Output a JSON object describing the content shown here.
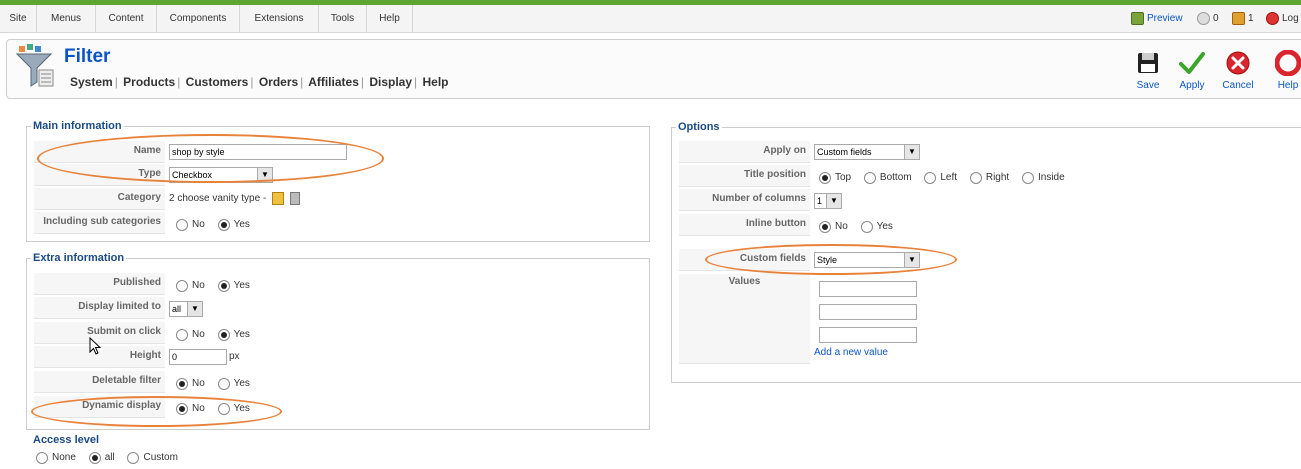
{
  "menubar": {
    "items": [
      "Site",
      "Menus",
      "Content",
      "Components",
      "Extensions",
      "Tools",
      "Help"
    ],
    "preview": "Preview",
    "messages_count": "0",
    "users_count": "1",
    "logout": "Log"
  },
  "header": {
    "title": "Filter",
    "submenu": [
      "System",
      "Products",
      "Customers",
      "Orders",
      "Affiliates",
      "Display",
      "Help"
    ]
  },
  "toolbar": {
    "save": "Save",
    "apply": "Apply",
    "cancel": "Cancel",
    "help": "Help"
  },
  "main_info": {
    "legend": "Main information",
    "name_label": "Name",
    "name_value": "shop by style",
    "type_label": "Type",
    "type_value": "Checkbox",
    "category_label": "Category",
    "category_value": "2 choose vanity type -",
    "sub_label": "Including sub categories",
    "no": "No",
    "yes": "Yes"
  },
  "extra_info": {
    "legend": "Extra information",
    "published_label": "Published",
    "limited_label": "Display limited to",
    "limited_value": "all",
    "submit_label": "Submit on click",
    "height_label": "Height",
    "height_value": "0",
    "height_unit": "px",
    "deletable_label": "Deletable filter",
    "dynamic_label": "Dynamic display",
    "no": "No",
    "yes": "Yes"
  },
  "access": {
    "title": "Access level",
    "none": "None",
    "all": "all",
    "custom": "Custom"
  },
  "options": {
    "legend": "Options",
    "apply_on_label": "Apply on",
    "apply_on_value": "Custom fields",
    "title_pos_label": "Title position",
    "top": "Top",
    "bottom": "Bottom",
    "left": "Left",
    "right": "Right",
    "inside": "Inside",
    "columns_label": "Number of columns",
    "columns_value": "1",
    "inline_label": "Inline button",
    "no": "No",
    "yes": "Yes",
    "custom_fields_label": "Custom fields",
    "custom_fields_value": "Style",
    "values_label": "Values",
    "add_value": "Add a new value"
  },
  "colors": {
    "accent": "#0b55c4",
    "highlight": "#e8823a",
    "topline": "#5ea630"
  }
}
